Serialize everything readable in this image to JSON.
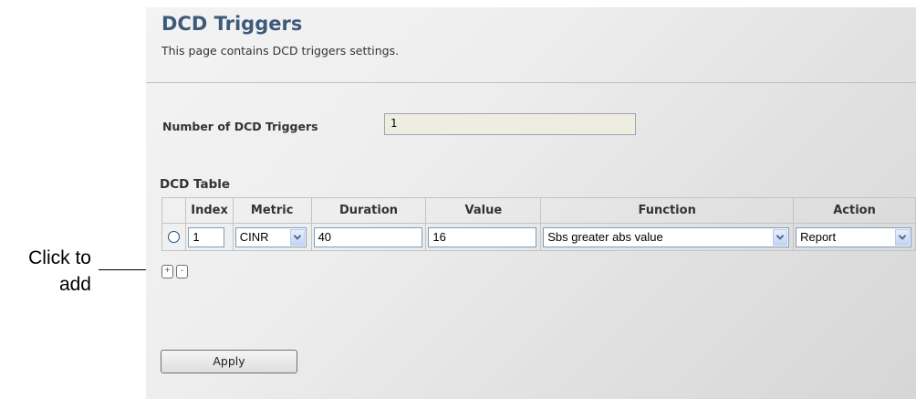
{
  "annotation": {
    "line1": "Click to",
    "line2": "add"
  },
  "page": {
    "title": "DCD Triggers",
    "subtitle": "This page contains DCD triggers settings."
  },
  "num_triggers": {
    "label": "Number of DCD Triggers",
    "value": "1"
  },
  "table": {
    "title": "DCD Table",
    "headers": [
      "Index",
      "Metric",
      "Duration",
      "Value",
      "Function",
      "Action"
    ],
    "rows": [
      {
        "index": "1",
        "metric": "CINR",
        "duration": "40",
        "value": "16",
        "function": "Sbs greater abs value",
        "action": "Report"
      }
    ]
  },
  "buttons": {
    "add": "+",
    "remove": "-",
    "apply": "Apply"
  },
  "icons": {
    "dropdown": "chevron-down-icon"
  },
  "colors": {
    "title": "#3d5a7a",
    "input_readonly": "#efece0",
    "border": "#c4c4c4"
  }
}
